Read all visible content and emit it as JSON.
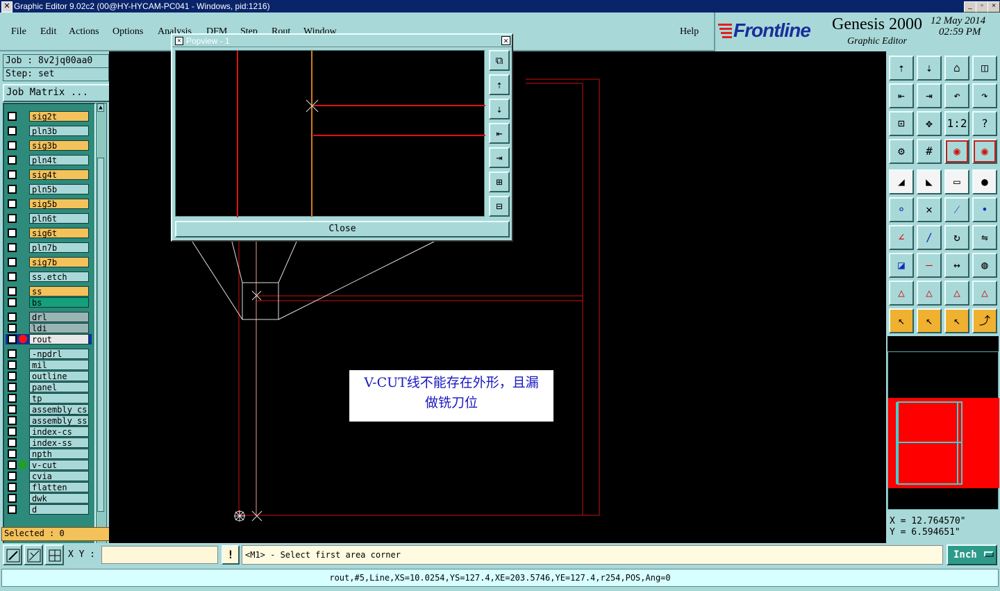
{
  "window": {
    "title": "Graphic Editor 9.02c2 (00@HY-HYCAM-PC041 - Windows, pid:1216)",
    "min_label": "_",
    "restore_label": "▫",
    "close_label": "×"
  },
  "menu": {
    "file": "File",
    "edit": "Edit",
    "actions": "Actions",
    "options": "Options",
    "analysis": "Analysis",
    "dfm": "DFM",
    "step": "Step",
    "rout": "Rout",
    "window": "Window",
    "help": "Help"
  },
  "brand": {
    "logo": "Frontline",
    "product": "Genesis 2000",
    "subtitle": "Graphic Editor",
    "date": "12 May 2014",
    "time": "02:59 PM"
  },
  "job": {
    "job_label": "Job : 8v2jq00aa0",
    "step_label": "Step: set",
    "matrix_button": "Job Matrix ..."
  },
  "layers": [
    {
      "name": "sig2t",
      "color": "#f4c25a"
    },
    {
      "name": "pln3b",
      "color": "#a9d8d8"
    },
    {
      "name": "sig3b",
      "color": "#f4c25a"
    },
    {
      "name": "pln4t",
      "color": "#a9d8d8"
    },
    {
      "name": "sig4t",
      "color": "#f4c25a"
    },
    {
      "name": "pln5b",
      "color": "#a9d8d8"
    },
    {
      "name": "sig5b",
      "color": "#f4c25a"
    },
    {
      "name": "pln6t",
      "color": "#a9d8d8"
    },
    {
      "name": "sig6t",
      "color": "#f4c25a"
    },
    {
      "name": "pln7b",
      "color": "#a9d8d8"
    },
    {
      "name": "sig7b",
      "color": "#f4c25a"
    },
    {
      "name": "ss.etch",
      "color": "#a9d8d8"
    },
    {
      "name": "ss",
      "color": "#f4c25a"
    },
    {
      "name": "bs",
      "color": "#14a07a"
    },
    {
      "name": "drl",
      "color": "#9ab4b4"
    },
    {
      "name": "ldi",
      "color": "#9ab4b4"
    },
    {
      "name": "rout",
      "color": "#e8e8e8"
    },
    {
      "name": "-npdrl",
      "color": "#a9d8d8"
    },
    {
      "name": "mil",
      "color": "#a9d8d8"
    },
    {
      "name": "outline",
      "color": "#a9d8d8"
    },
    {
      "name": "panel",
      "color": "#a9d8d8"
    },
    {
      "name": "tp",
      "color": "#a9d8d8"
    },
    {
      "name": "assembly_cs",
      "color": "#a9d8d8"
    },
    {
      "name": "assembly_ss",
      "color": "#a9d8d8"
    },
    {
      "name": "index-cs",
      "color": "#a9d8d8"
    },
    {
      "name": "index-ss",
      "color": "#a9d8d8"
    },
    {
      "name": "npth",
      "color": "#a9d8d8"
    },
    {
      "name": "v-cut",
      "color": "#a9d8d8"
    },
    {
      "name": "cvia",
      "color": "#a9d8d8"
    },
    {
      "name": "flatten",
      "color": "#a9d8d8"
    },
    {
      "name": "dwk",
      "color": "#a9d8d8"
    },
    {
      "name": "d",
      "color": "#a9d8d8"
    }
  ],
  "selected_label": "Selected : 0",
  "popview": {
    "title": "Popview - 1",
    "close_button": "Close"
  },
  "annotation": {
    "line1": "V-CUT线不能存在外形，且漏",
    "line2": "做铣刀位"
  },
  "coords": {
    "x": "X =  12.764570\"",
    "y": "Y =  6.594651\""
  },
  "command": {
    "xy_label": "X Y :",
    "xy_value": "",
    "prompt": "<M1> - Select first area corner",
    "units": "Inch"
  },
  "status_text": "rout,#5,Line,XS=10.0254,YS=127.4,XE=203.5746,YE=127.4,r254,POS,Ang=0"
}
